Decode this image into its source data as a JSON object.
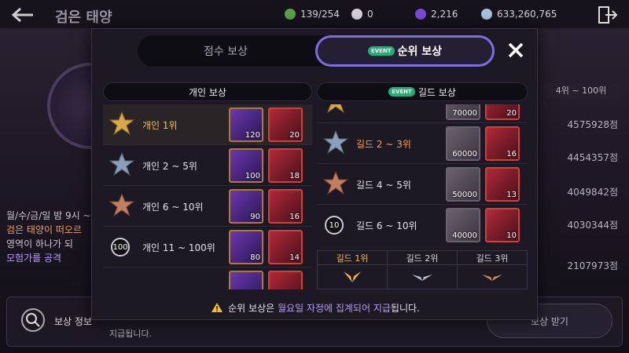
{
  "header": {
    "title": "검은 태양",
    "resources": [
      {
        "icon": "stamina-icon",
        "value": "139/254",
        "color": "#5aa04a"
      },
      {
        "icon": "pearl-icon",
        "value": "0",
        "color": "#d8d0d8"
      },
      {
        "icon": "crystal-icon",
        "value": "2,216",
        "color": "#7a4ad8"
      },
      {
        "icon": "silver-coin-icon",
        "value": "633,260,765",
        "color": "#a8c0e0"
      }
    ]
  },
  "background": {
    "right_header": "4위 ~ 100위",
    "scores": [
      "4575928점",
      "4454357점",
      "4049842점",
      "4030344점",
      "2107973점"
    ],
    "left_lines": [
      "월/수/금/일 밤 9시 ~",
      "검은 태양이 떠오르",
      "영역이 하나가 되",
      "모험가를 공격"
    ],
    "bottom_left": "보상 정보",
    "bottom_text": "지급됩니다.",
    "claim_label": "보상 받기"
  },
  "modal": {
    "tab_score": "점수 보상",
    "tab_rank": "순위 보상",
    "event_badge": "EVENT",
    "personal_header": "개인 보상",
    "guild_header": "길드 보상",
    "personal_rows": [
      {
        "label": "개인 1위",
        "rank": "",
        "items": [
          {
            "kind": "purple",
            "qty": "120"
          },
          {
            "kind": "red",
            "qty": "20"
          }
        ]
      },
      {
        "label": "개인 2 ~ 5위",
        "rank": "",
        "items": [
          {
            "kind": "purple",
            "qty": "100"
          },
          {
            "kind": "red",
            "qty": "18"
          }
        ]
      },
      {
        "label": "개인 6 ~ 10위",
        "rank": "",
        "items": [
          {
            "kind": "purple",
            "qty": "90"
          },
          {
            "kind": "red",
            "qty": "16"
          }
        ]
      },
      {
        "label": "개인 11 ~ 100위",
        "rank": "100",
        "items": [
          {
            "kind": "purple",
            "qty": "80"
          },
          {
            "kind": "red",
            "qty": "14"
          }
        ]
      }
    ],
    "guild_rows": [
      {
        "label": "",
        "rank": "",
        "items": [
          {
            "kind": "coin",
            "qty": "70000"
          },
          {
            "kind": "red",
            "qty": "20"
          }
        ]
      },
      {
        "label": "길드 2 ~ 3위",
        "rank": "",
        "items": [
          {
            "kind": "coin",
            "qty": "60000"
          },
          {
            "kind": "red",
            "qty": "16"
          }
        ]
      },
      {
        "label": "길드 4 ~ 5위",
        "rank": "",
        "items": [
          {
            "kind": "coin",
            "qty": "50000"
          },
          {
            "kind": "red",
            "qty": "13"
          }
        ]
      },
      {
        "label": "길드 6 ~ 10위",
        "rank": "10",
        "items": [
          {
            "kind": "coin",
            "qty": "40000"
          },
          {
            "kind": "red",
            "qty": "10"
          }
        ]
      }
    ],
    "guild_table": [
      "길드 1위",
      "길드 2위",
      "길드 3위"
    ],
    "notice_pre": "순위 보상은 ",
    "notice_hl": "월요일 자정에 집계되어 지급",
    "notice_post": "됩니다."
  },
  "colors": {
    "accent": "#7b6ee0",
    "gold": "#f5c25a",
    "event": "#1fb07a"
  }
}
